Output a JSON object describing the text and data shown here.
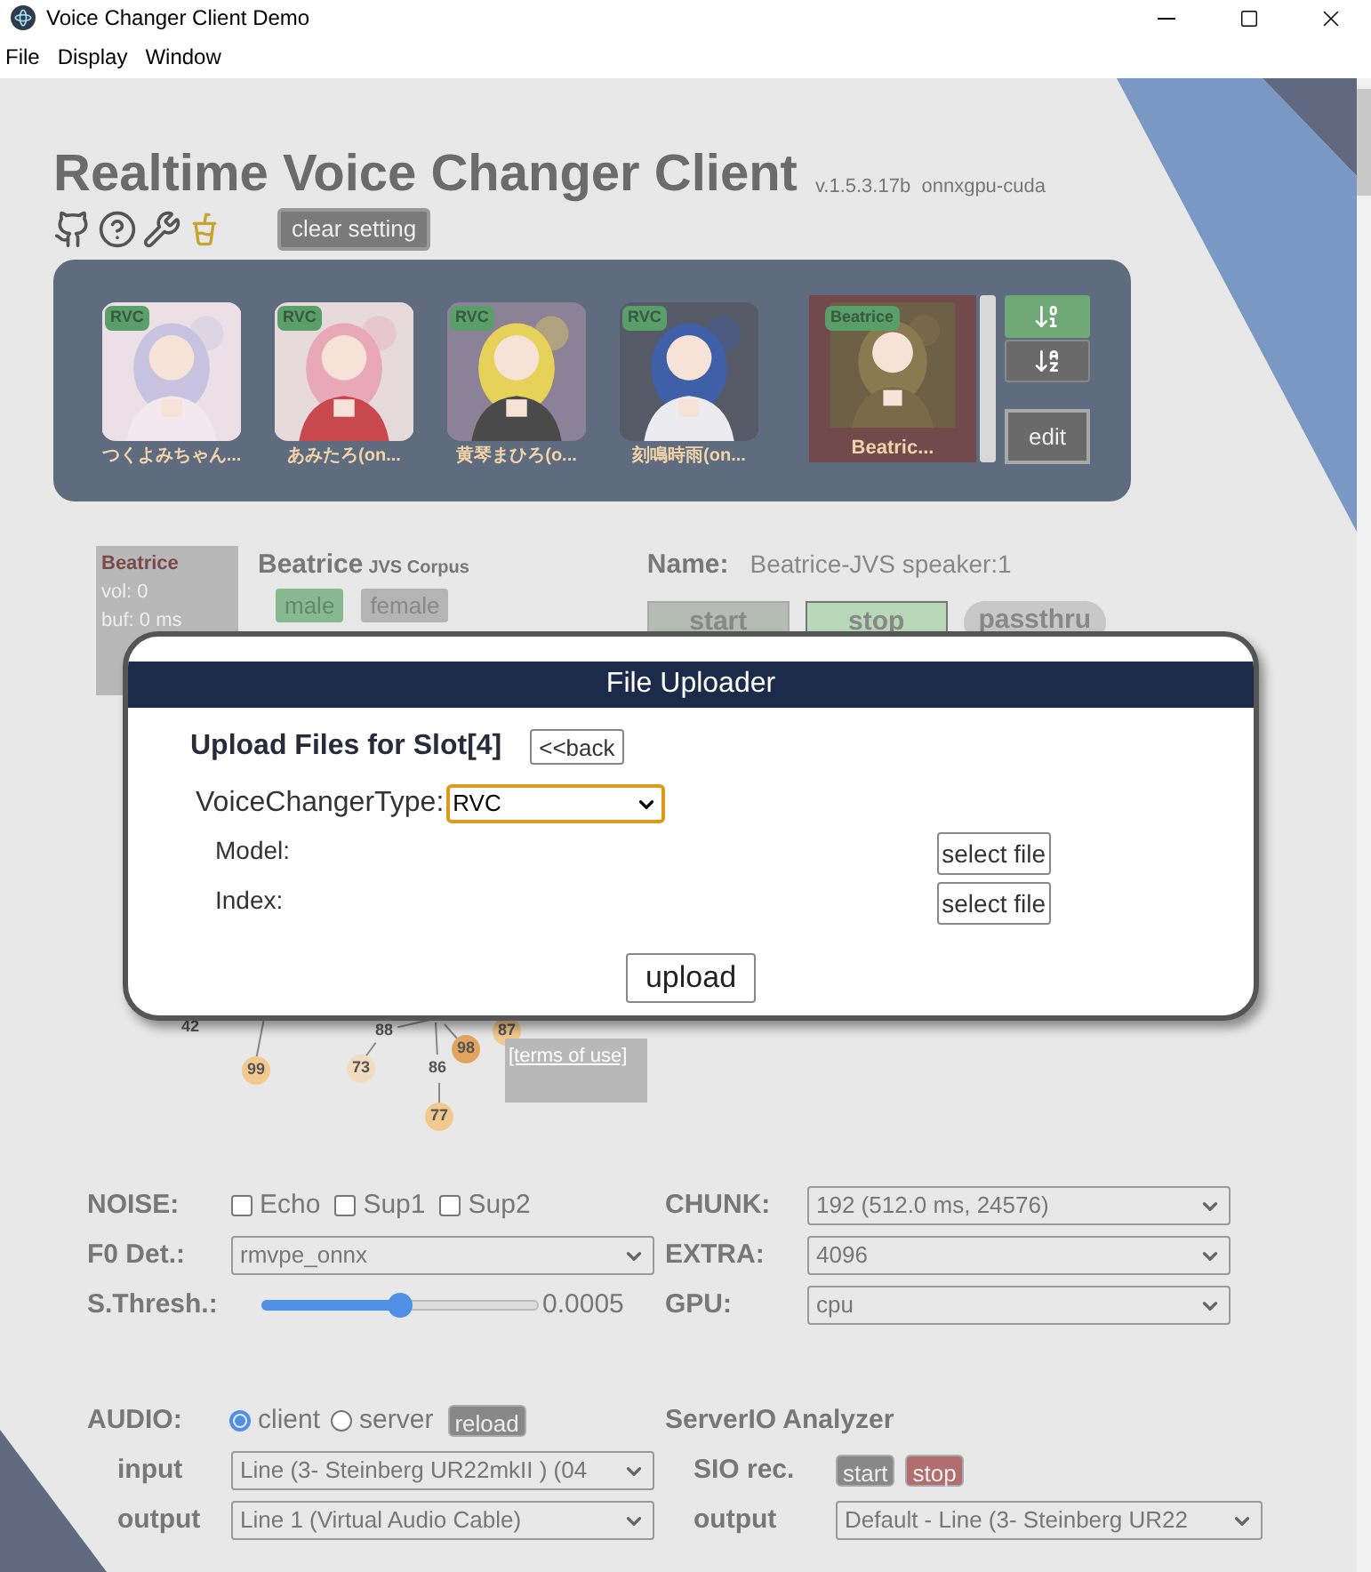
{
  "window": {
    "title": "Voice Changer Client Demo"
  },
  "menu": [
    "File",
    "Display",
    "Window"
  ],
  "header": {
    "title": "Realtime Voice Changer Client",
    "version": "v.1.5.3.17b",
    "build": "onnxgpu-cuda",
    "clear_button": "clear setting"
  },
  "slots": [
    {
      "badge": "RVC",
      "name": "つくよみちゃん...",
      "selected": false
    },
    {
      "badge": "RVC",
      "name": "あみたろ(on...",
      "selected": false
    },
    {
      "badge": "RVC",
      "name": "黄琴まひろ(o...",
      "selected": false
    },
    {
      "badge": "RVC",
      "name": "刻鳴時雨(on...",
      "selected": false
    },
    {
      "badge": "Beatrice",
      "name": "Beatric...",
      "selected": true
    }
  ],
  "sort_buttons": [
    {
      "kind": "numeric",
      "selected": true
    },
    {
      "kind": "alpha",
      "selected": false
    }
  ],
  "edit_button": "edit",
  "status": {
    "model": "Beatrice",
    "lines": [
      "vol: 0",
      "buf: 0 ms"
    ]
  },
  "model_info": {
    "name": "Beatrice",
    "subtitle": "JVS Corpus",
    "tags": [
      {
        "label": "male",
        "selected": true
      },
      {
        "label": "female",
        "selected": false
      }
    ]
  },
  "speaker": {
    "label": "Name:",
    "value": "Beatrice-JVS speaker:1"
  },
  "run_buttons": [
    {
      "label": "start",
      "selected": false
    },
    {
      "label": "stop",
      "selected": true
    },
    {
      "label": "passthru",
      "selected": false
    }
  ],
  "graph": {
    "nodes": [
      {
        "label": "42",
        "color": "#e8e8e8"
      },
      {
        "label": "99",
        "color": "#f2c98f"
      },
      {
        "label": "88",
        "color": "#e8e8e8"
      },
      {
        "label": "73",
        "color": "#f1dcc0"
      },
      {
        "label": "86",
        "color": "#e8e8e8"
      },
      {
        "label": "77",
        "color": "#f2c98f"
      },
      {
        "label": "98",
        "color": "#e2a560"
      },
      {
        "label": "87",
        "color": "#f2c98f"
      }
    ],
    "link": "[terms of use]"
  },
  "uploader": {
    "title": "File Uploader",
    "heading": "Upload Files for Slot[4]",
    "back": "<<back",
    "type_label": "VoiceChangerType:",
    "type_value": "RVC",
    "files": [
      {
        "label": "Model:",
        "button": "select file"
      },
      {
        "label": "Index:",
        "button": "select file"
      }
    ],
    "upload": "upload"
  },
  "noise": {
    "label": "NOISE:",
    "options": [
      {
        "label": "Echo",
        "checked": false
      },
      {
        "label": "Sup1",
        "checked": false
      },
      {
        "label": "Sup2",
        "checked": false
      }
    ]
  },
  "f0": {
    "label": "F0 Det.:",
    "value": "rmvpe_onnx"
  },
  "threshold": {
    "label": "S.Thresh.:",
    "level": 0.5,
    "reading": "0.0005"
  },
  "right_settings": [
    {
      "label": "CHUNK:",
      "value": "192 (512.0 ms, 24576)"
    },
    {
      "label": "EXTRA:",
      "value": "4096"
    },
    {
      "label": "GPU:",
      "value": "cpu"
    }
  ],
  "audio": {
    "label": "AUDIO:",
    "modes": [
      {
        "label": "client",
        "selected": true
      },
      {
        "label": "server",
        "selected": false
      }
    ],
    "reload": "reload",
    "rows": [
      {
        "label": "input",
        "value": "Line (3- Steinberg UR22mkII ) (04"
      },
      {
        "label": "output",
        "value": "Line 1 (Virtual Audio Cable)"
      }
    ]
  },
  "analyzer": {
    "title": "ServerIO Analyzer",
    "rec_label": "SIO rec.",
    "buttons": [
      {
        "label": "start",
        "kind": "start"
      },
      {
        "label": "stop",
        "kind": "stop"
      }
    ],
    "output_label": "output",
    "output_value": "Default - Line (3- Steinberg UR22"
  }
}
